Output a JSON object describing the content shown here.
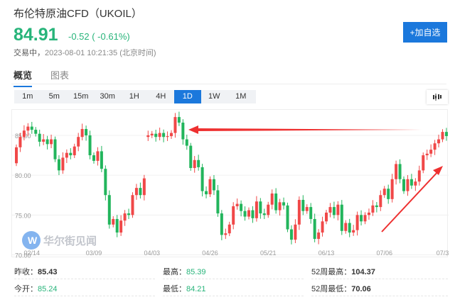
{
  "header": {
    "title": "布伦特原油CFD（UKOIL）",
    "price": "84.91",
    "change": "-0.52 ( -0.61%)",
    "status": "交易中，",
    "timestamp": "2023-08-01 10:21:35 (北京时间)",
    "add_button": "+加自选"
  },
  "tabs": [
    {
      "label": "概览",
      "active": true
    },
    {
      "label": "图表",
      "active": false
    }
  ],
  "timeframes": [
    {
      "label": "1m"
    },
    {
      "label": "5m"
    },
    {
      "label": "15m"
    },
    {
      "label": "30m"
    },
    {
      "label": "1H"
    },
    {
      "label": "4H"
    },
    {
      "label": "1D",
      "active": true
    },
    {
      "label": "1W"
    },
    {
      "label": "1M"
    }
  ],
  "watermark": "华尔街见闻",
  "colors": {
    "up": "#f04848",
    "down": "#22b55c",
    "accent": "#1b78dc"
  },
  "chart_data": {
    "type": "candlestick",
    "note": "open = previous close unless listed in open_overrides",
    "yticks": [
      "85.00",
      "80.00",
      "75.00",
      "70.00"
    ],
    "ylim": [
      69.6,
      88.2
    ],
    "xticks": [
      {
        "label": "02/14",
        "index": 4
      },
      {
        "label": "03/09",
        "index": 20
      },
      {
        "label": "04/03",
        "index": 35
      },
      {
        "label": "04/26",
        "index": 50
      },
      {
        "label": "05/21",
        "index": 65
      },
      {
        "label": "06/13",
        "index": 80
      },
      {
        "label": "07/06",
        "index": 95
      },
      {
        "label": "07/3",
        "index": 110
      }
    ],
    "first_open": 81.5,
    "open_overrides": {
      "34": 84.8
    },
    "close": [
      83.5,
      84.8,
      85.6,
      86.1,
      85.7,
      85.2,
      84.2,
      84.5,
      83.9,
      84.5,
      82.0,
      80.6,
      82.2,
      82.8,
      82.5,
      83.6,
      84.8,
      85.8,
      85.0,
      82.5,
      81.8,
      83.0,
      80.8,
      77.5,
      73.8,
      74.5,
      72.8,
      74.3,
      75.2,
      75.0,
      77.5,
      78.4,
      77.5,
      79.6,
      85.0,
      85.2,
      84.8,
      85.3,
      84.8,
      84.9,
      85.3,
      87.3,
      86.6,
      84.5,
      83.7,
      80.9,
      81.9,
      81.0,
      78.0,
      77.6,
      79.5,
      78.1,
      75.2,
      72.5,
      72.7,
      73.8,
      76.1,
      76.4,
      75.5,
      74.8,
      75.6,
      74.6,
      76.7,
      75.2,
      75.0,
      76.3,
      77.7,
      75.6,
      76.6,
      76.2,
      73.2,
      71.9,
      73.8,
      76.9,
      75.5,
      76.0,
      74.5,
      72.0,
      72.8,
      74.2,
      75.3,
      76.0,
      75.0,
      76.3,
      73.0,
      74.0,
      72.8,
      73.1,
      75.0,
      74.2,
      75.0,
      75.3,
      76.2,
      76.0,
      77.5,
      78.3,
      77.0,
      79.5,
      81.4,
      79.5,
      78.0,
      79.5,
      78.7,
      79.2,
      80.6,
      82.5,
      82.7,
      83.2,
      84.0,
      84.5,
      85.43,
      84.91
    ]
  },
  "stats": [
    {
      "label": "昨收：",
      "value": "85.43",
      "color": "dark"
    },
    {
      "label": "最高：",
      "value": "85.39",
      "color": "green"
    },
    {
      "label": "52周最高：",
      "value": "104.37",
      "color": "dark"
    },
    {
      "label": "今开：",
      "value": "85.24",
      "color": "green"
    },
    {
      "label": "最低：",
      "value": "84.21",
      "color": "green"
    },
    {
      "label": "52周最低：",
      "value": "70.06",
      "color": "dark"
    }
  ]
}
